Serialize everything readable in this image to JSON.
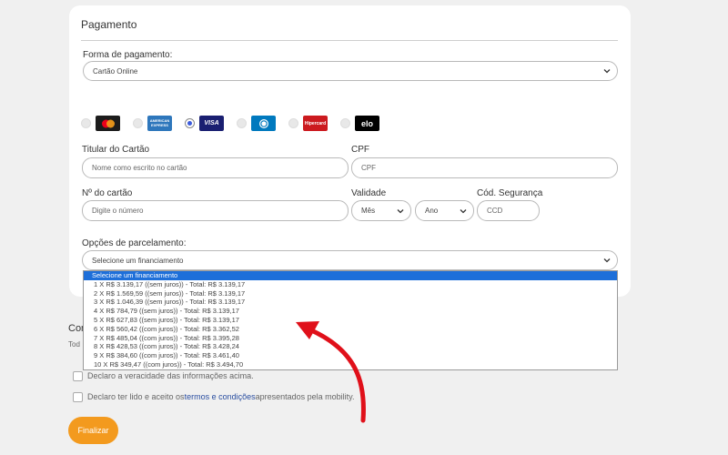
{
  "payment": {
    "section_title": "Pagamento",
    "method_label": "Forma de pagamento:",
    "method_value": "Cartão Online",
    "card_brands": [
      {
        "name": "mastercard",
        "selected": false,
        "color": "#eb001b"
      },
      {
        "name": "amex",
        "text": "AMERICAN EXPRESS",
        "selected": false,
        "color": "#2e77bc"
      },
      {
        "name": "visa",
        "text": "VISA",
        "selected": true,
        "color": "#1a1f71"
      },
      {
        "name": "diners",
        "selected": false,
        "color": "#0079be"
      },
      {
        "name": "hipercard",
        "text": "Hipercard",
        "selected": false,
        "color": "#cc1a1f"
      },
      {
        "name": "elo",
        "text": "elo",
        "selected": false,
        "color": "#000000"
      }
    ],
    "holder_label": "Titular do Cartão",
    "holder_placeholder": "Nome como escrito no cartão",
    "cpf_label": "CPF",
    "cpf_placeholder": "CPF",
    "number_label": "Nº do cartão",
    "number_placeholder": "Digite o número",
    "validity_label": "Validade",
    "month_value": "Mês",
    "year_value": "Ano",
    "security_label": "Cód. Segurança",
    "security_placeholder": "CCD",
    "installments_label": "Opções de parcelamento:",
    "installments_value": "Selecione um financiamento",
    "installments_options": [
      "Selecione um financiamento",
      "1 X R$ 3.139,17 ((sem juros)) - Total: R$ 3.139,17",
      "2 X R$ 1.569,59 ((sem juros)) - Total: R$ 3.139,17",
      "3 X R$ 1.046,39 ((sem juros)) - Total: R$ 3.139,17",
      "4 X R$ 784,79 ((sem juros)) - Total: R$ 3.139,17",
      "5 X R$ 627,83 ((sem juros)) - Total: R$ 3.139,17",
      "6 X R$ 560,42 ((com juros)) - Total: R$ 3.362,52",
      "7 X R$ 485,04 ((com juros)) - Total: R$ 3.395,28",
      "8 X R$ 428,53 ((com juros)) - Total: R$ 3.428,24",
      "9 X R$ 384,60 ((com juros)) - Total: R$ 3.461,40",
      "10 X R$ 349,47 ((com juros)) - Total: R$ 3.494,70"
    ]
  },
  "background": {
    "heading_fragment": "Con",
    "subtext_fragment": "Tod",
    "declare_truth": "Declaro a veracidade das informações acima.",
    "declare_terms_prefix": "Declaro ter lido e aceito os",
    "terms_link": "termos e condições",
    "declare_terms_suffix": "apresentados pela mobility."
  },
  "actions": {
    "finalize_label": "Finalizar"
  },
  "colors": {
    "accent": "#f39a1e",
    "selected_option": "#1e6fd9",
    "arrow": "#e0101a"
  }
}
